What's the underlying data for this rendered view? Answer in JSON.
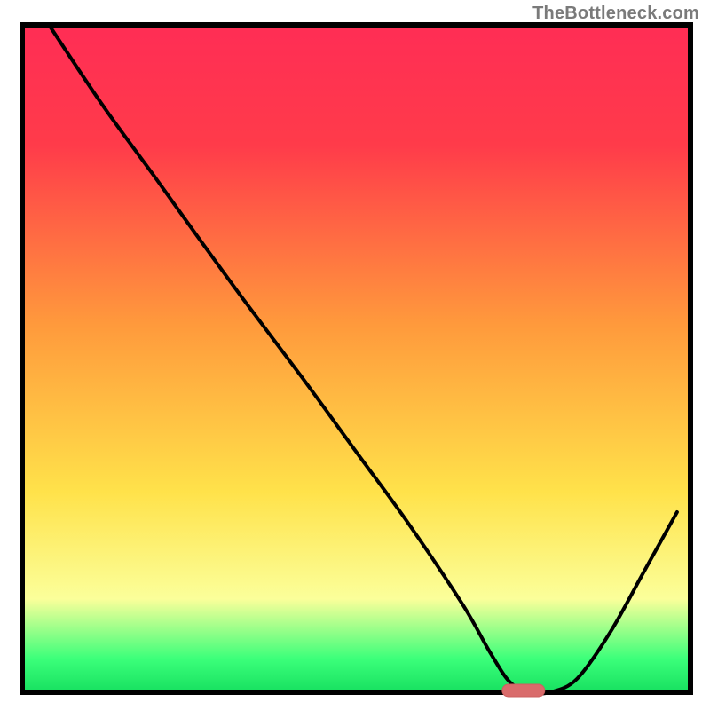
{
  "attribution": "TheBottleneck.com",
  "colors": {
    "frame": "#000000",
    "curve": "#000000",
    "marker_fill": "#d96b6b",
    "marker_stroke": "#cc5f5f",
    "gradient_top": "#ff2d55",
    "gradient_red": "#ff3b4a",
    "gradient_orange": "#ff9a3c",
    "gradient_yellow": "#ffe24a",
    "gradient_pale": "#fbff9a",
    "gradient_green": "#3bff7a",
    "gradient_green_deep": "#17e060"
  },
  "chart_data": {
    "type": "line",
    "title": "",
    "xlabel": "",
    "ylabel": "",
    "xlim": [
      0,
      100
    ],
    "ylim": [
      0,
      100
    ],
    "annotations": [
      "TheBottleneck.com"
    ],
    "legend": [],
    "optimum_marker": {
      "x": 75,
      "y": 0
    },
    "series": [
      {
        "name": "bottleneck-curve",
        "x": [
          4,
          12,
          20,
          25,
          33,
          42,
          50,
          58,
          66,
          70,
          73,
          76,
          79,
          83,
          88,
          93,
          98
        ],
        "y": [
          100,
          88,
          77,
          70,
          59,
          47,
          36,
          25,
          13,
          6,
          1.5,
          0,
          0,
          2,
          9,
          18,
          27
        ]
      }
    ],
    "background_gradient_stops": [
      {
        "pct": 0,
        "color": "#ff2d55"
      },
      {
        "pct": 18,
        "color": "#ff3b4a"
      },
      {
        "pct": 45,
        "color": "#ff9a3c"
      },
      {
        "pct": 70,
        "color": "#ffe24a"
      },
      {
        "pct": 86,
        "color": "#fbff9a"
      },
      {
        "pct": 95,
        "color": "#3bff7a"
      },
      {
        "pct": 100,
        "color": "#17e060"
      }
    ]
  }
}
